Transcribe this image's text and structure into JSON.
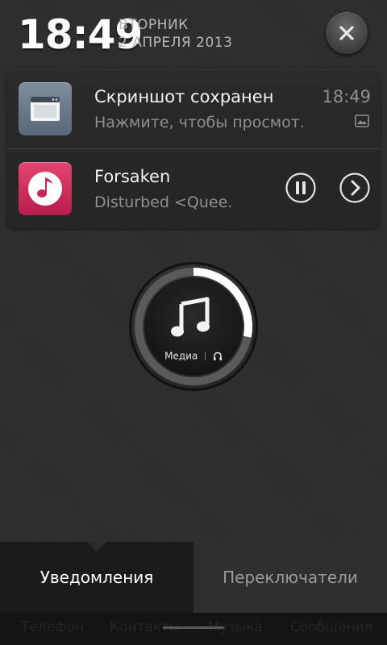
{
  "status": {
    "time": "18:49",
    "weekday": "ВТОРНИК",
    "date": "2 АПРЕЛЯ 2013"
  },
  "notifications": [
    {
      "icon": "screenshot-app-icon",
      "title": "Скриншот сохранен",
      "subtitle": "Нажмите, чтобы просмот.",
      "time": "18:49",
      "badge_icon": "image-icon"
    },
    {
      "icon": "music-app-icon",
      "title": "Forsaken",
      "subtitle": "Disturbed  <Quee.",
      "controls": [
        "pause-icon",
        "next-icon"
      ]
    }
  ],
  "media": {
    "label": "Медиа",
    "progress": 0.28
  },
  "tabs": [
    {
      "label": "Уведомления",
      "active": true
    },
    {
      "label": "Переключатели",
      "active": false
    }
  ],
  "bottom_bar": {
    "items": [
      "Телефон",
      "Контакты",
      "Музыка",
      "Сообщения"
    ]
  },
  "colors": {
    "accent_music": "#d02a5b",
    "panel": "#282828",
    "text_secondary": "#8f8f8f"
  }
}
